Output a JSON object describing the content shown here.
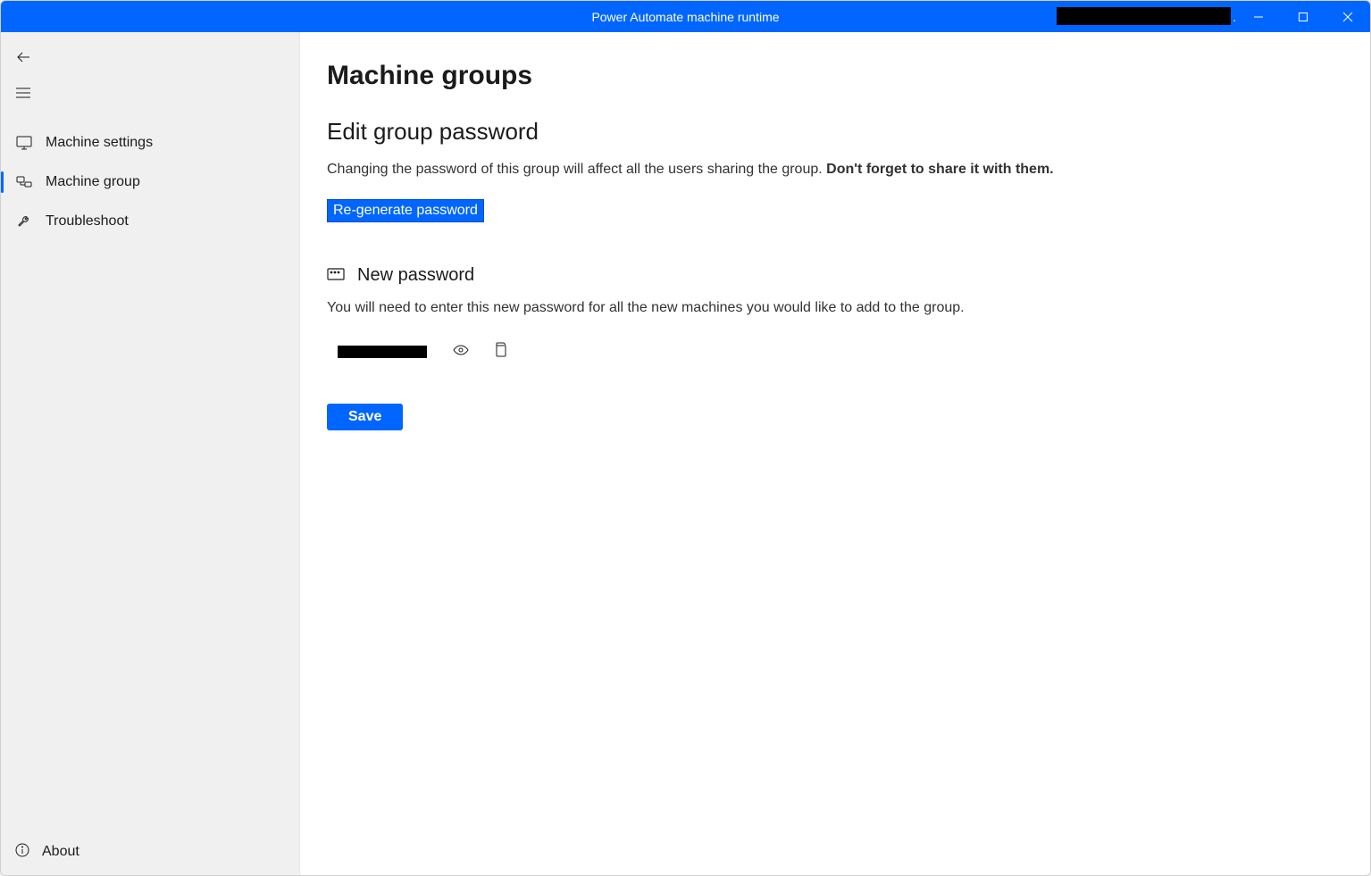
{
  "titlebar": {
    "title": "Power Automate machine runtime"
  },
  "sidebar": {
    "items": [
      {
        "label": "Machine settings",
        "icon": "monitor-icon"
      },
      {
        "label": "Machine group",
        "icon": "group-icon"
      },
      {
        "label": "Troubleshoot",
        "icon": "wrench-icon"
      }
    ],
    "active_index": 1,
    "about_label": "About"
  },
  "main": {
    "page_title": "Machine groups",
    "section_title": "Edit group password",
    "section_desc_text": "Changing the password of this group will affect all the users sharing the group. ",
    "section_desc_strong": "Don't forget to share it with them.",
    "regenerate_label": "Re-generate password",
    "new_pw_label": "New password",
    "new_pw_desc": "You will need to enter this new password for all the new machines you would like to add to the group.",
    "save_label": "Save"
  }
}
